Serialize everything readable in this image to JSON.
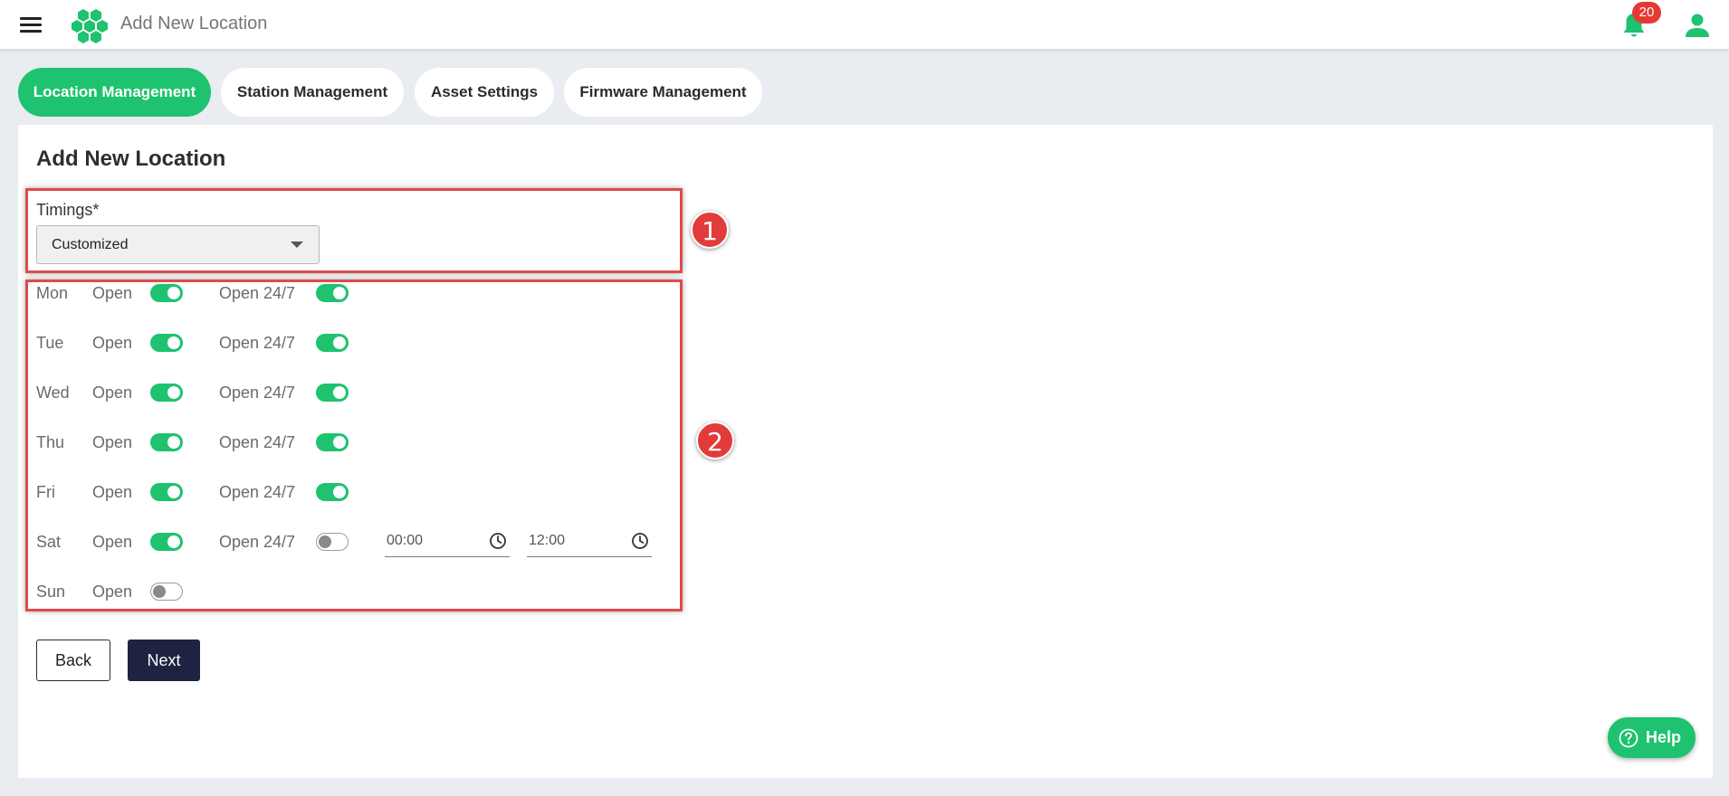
{
  "header": {
    "title": "Add New Location",
    "notification_count": "20"
  },
  "tabs": [
    {
      "label": "Location Management",
      "active": true
    },
    {
      "label": "Station Management",
      "active": false
    },
    {
      "label": "Asset Settings",
      "active": false
    },
    {
      "label": "Firmware Management",
      "active": false
    }
  ],
  "form": {
    "title": "Add New Location",
    "timings_label": "Timings*",
    "timings_value": "Customized",
    "open_label": "Open",
    "open247_label": "Open 24/7",
    "days": [
      {
        "day": "Mon",
        "open": true,
        "open247": true
      },
      {
        "day": "Tue",
        "open": true,
        "open247": true
      },
      {
        "day": "Wed",
        "open": true,
        "open247": true
      },
      {
        "day": "Thu",
        "open": true,
        "open247": true
      },
      {
        "day": "Fri",
        "open": true,
        "open247": true
      },
      {
        "day": "Sat",
        "open": true,
        "open247": false,
        "start_time": "00:00",
        "end_time": "12:00"
      },
      {
        "day": "Sun",
        "open": false
      }
    ]
  },
  "annotations": {
    "box1": "1",
    "box2": "2"
  },
  "buttons": {
    "back": "Back",
    "next": "Next",
    "help": "Help"
  },
  "colors": {
    "accent": "#1ec26f",
    "dark": "#1d2340",
    "badge": "#e53935",
    "annotation": "#e04b4b"
  }
}
